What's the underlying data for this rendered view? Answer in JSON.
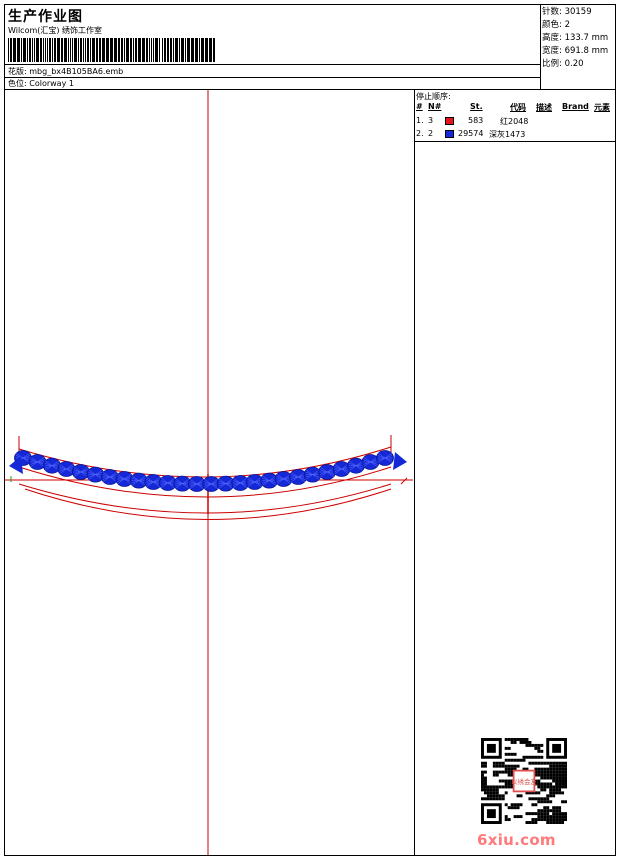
{
  "header": {
    "title": "生产作业图",
    "company": "Wilcom(汇宝) 绣饰工作室",
    "design_label": "花版:",
    "design_value": "mbg_bx4B105BA6.emb",
    "colorway_label": "色位:",
    "colorway_value": "Colorway 1"
  },
  "specs": [
    {
      "label": "针数:",
      "value": "30159"
    },
    {
      "label": "颜色:",
      "value": "2"
    },
    {
      "label": "高度:",
      "value": "133.7 mm"
    },
    {
      "label": "宽度:",
      "value": "691.8 mm"
    },
    {
      "label": "比例:",
      "value": "0.20"
    }
  ],
  "stops": {
    "title": "停止顺序:",
    "headers": {
      "hash": "#",
      "n": "N#",
      "st": "St.",
      "code": "代码",
      "desc": "描述",
      "brand": "Brand",
      "element": "元素"
    },
    "rows": [
      {
        "index": "1.",
        "n": "3",
        "color": "#e8141b",
        "st": "583",
        "code": "红2048"
      },
      {
        "index": "2.",
        "n": "2",
        "color": "#1428d8",
        "st": "29574",
        "code": "深灰1473"
      }
    ]
  },
  "colors": {
    "guide": "#cc0000",
    "stitch_red": "#e8141b",
    "stitch_blue": "#1428d8"
  },
  "watermark": {
    "logo_text": "6xiu.com",
    "seal_text": "以绣会友"
  }
}
